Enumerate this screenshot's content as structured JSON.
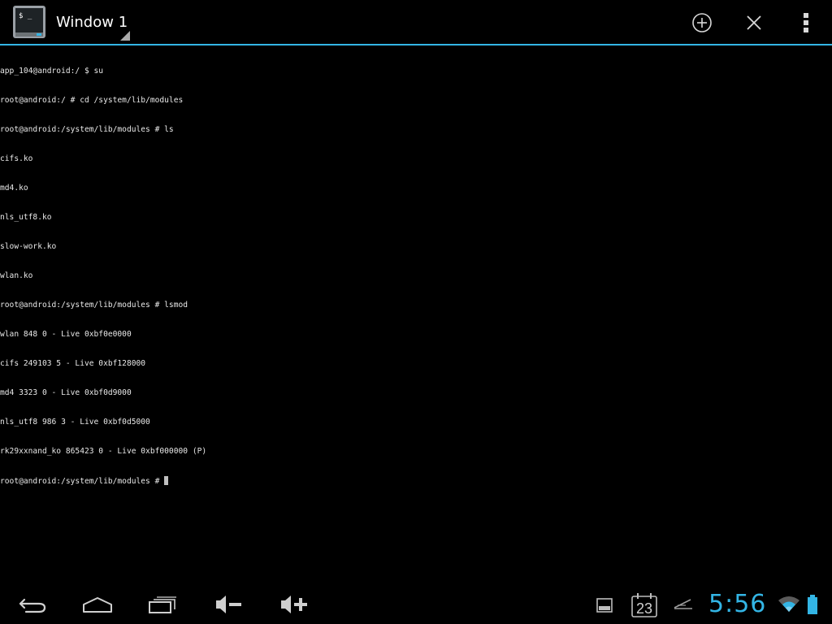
{
  "action_bar": {
    "window_title": "Window 1",
    "app_icon_glyph": "$ _",
    "buttons": {
      "new_window": "plus-circle-icon",
      "close_window": "close-icon",
      "overflow": "overflow-menu-icon"
    },
    "accent_color": "#33b5e5"
  },
  "terminal": {
    "lines": [
      "app_104@android:/ $ su",
      "root@android:/ # cd /system/lib/modules",
      "root@android:/system/lib/modules # ls",
      "cifs.ko",
      "md4.ko",
      "nls_utf8.ko",
      "slow-work.ko",
      "wlan.ko",
      "root@android:/system/lib/modules # lsmod",
      "wlan 848 0 - Live 0xbf0e0000",
      "cifs 249103 5 - Live 0xbf128000",
      "md4 3323 0 - Live 0xbf0d9000",
      "nls_utf8 986 3 - Live 0xbf0d5000",
      "rk29xxnand_ko 865423 0 - Live 0xbf000000 (P)"
    ],
    "prompt": "root@android:/system/lib/modules # ",
    "text_color": "#e8e8e8",
    "background": "#000000"
  },
  "system_bar": {
    "nav": [
      "back-icon",
      "home-icon",
      "recents-icon",
      "volume-down-icon",
      "volume-up-icon"
    ],
    "calendar_day": "23",
    "clock": "5:56",
    "clock_color": "#33b5e5"
  }
}
